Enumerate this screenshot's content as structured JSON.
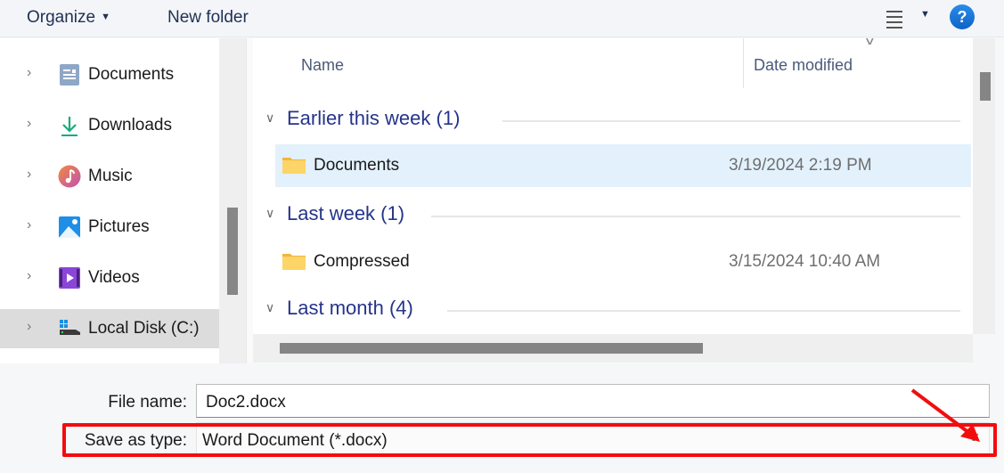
{
  "toolbar": {
    "organize_label": "Organize",
    "organize_caret": "▼",
    "new_folder_label": "New folder",
    "view_caret": "▼",
    "help_label": "?"
  },
  "nav": {
    "items": [
      {
        "label": "Documents",
        "icon": "documents-icon",
        "selected": false
      },
      {
        "label": "Downloads",
        "icon": "downloads-icon",
        "selected": false
      },
      {
        "label": "Music",
        "icon": "music-icon",
        "selected": false
      },
      {
        "label": "Pictures",
        "icon": "pictures-icon",
        "selected": false
      },
      {
        "label": "Videos",
        "icon": "videos-icon",
        "selected": false
      },
      {
        "label": "Local Disk (C:)",
        "icon": "local-disk-icon",
        "selected": true
      }
    ],
    "chevron": "›"
  },
  "list": {
    "columns": {
      "name": "Name",
      "date_modified": "Date modified",
      "sort_glyph": "∨"
    },
    "groups": [
      {
        "label": "Earlier this week (1)",
        "chevron": "∨",
        "items": [
          {
            "name": "Documents",
            "date": "3/19/2024 2:19 PM",
            "selected": true
          }
        ]
      },
      {
        "label": "Last week (1)",
        "chevron": "∨",
        "items": [
          {
            "name": "Compressed",
            "date": "3/15/2024 10:40 AM",
            "selected": false
          }
        ]
      },
      {
        "label": "Last month (4)",
        "chevron": "∨",
        "items": []
      }
    ]
  },
  "form": {
    "file_name_label": "File name:",
    "file_name_value": "Doc2.docx",
    "save_type_label": "Save as type:",
    "save_type_value": "Word Document (*.docx)",
    "dropdown_chevron": "∨"
  },
  "colors": {
    "accent": "#0e63c8",
    "group_header": "#25348a",
    "selection": "#e3f1fc",
    "annotation": "#f20d0d"
  }
}
